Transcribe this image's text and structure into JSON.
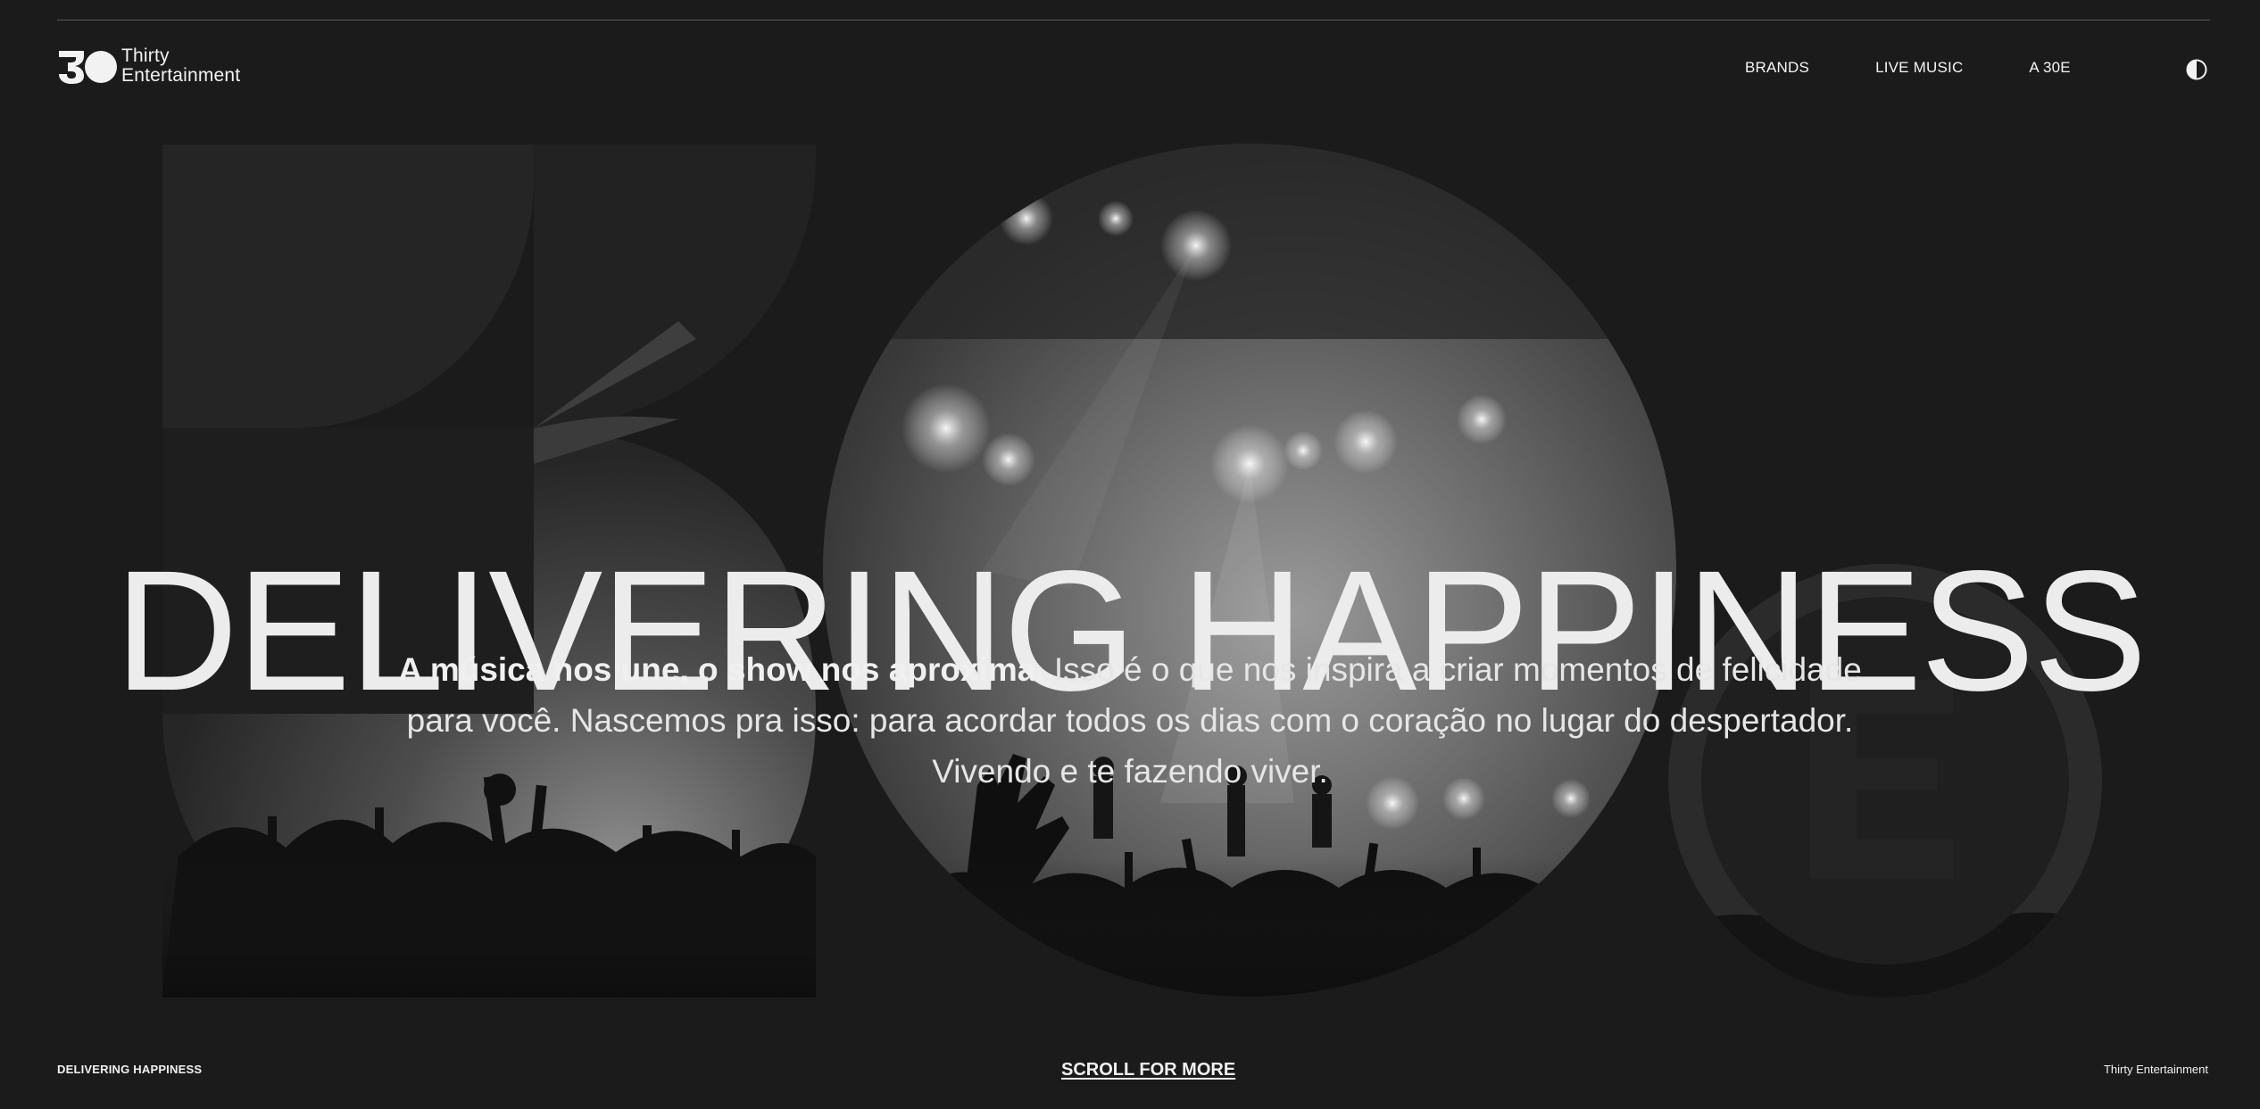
{
  "brand": {
    "mark": "30",
    "name_line1": "Thirty",
    "name_line2": "Entertainment"
  },
  "nav": {
    "items": [
      {
        "label": "BRANDS"
      },
      {
        "label": "LIVE MUSIC"
      },
      {
        "label": "A 30E"
      }
    ],
    "theme_toggle_icon": "half-circle-contrast-icon"
  },
  "hero": {
    "headline": "DELIVERING HAPPINESS",
    "lead_bold": "A música nos une, o show nos aproxima.",
    "lead_rest": " Isso é o que nos inspira a criar momentos de felicidade para você. Nascemos pra isso: para acordar todos os dias com o coração no lugar do despertador. Vivendo e te fazendo viver.",
    "background_image": "concert-crowd-photo"
  },
  "footer": {
    "left": "DELIVERING HAPPINESS",
    "center": "SCROLL FOR MORE",
    "right": "Thirty Entertainment"
  },
  "colors": {
    "background": "#1b1b1c",
    "text": "#ececec"
  }
}
